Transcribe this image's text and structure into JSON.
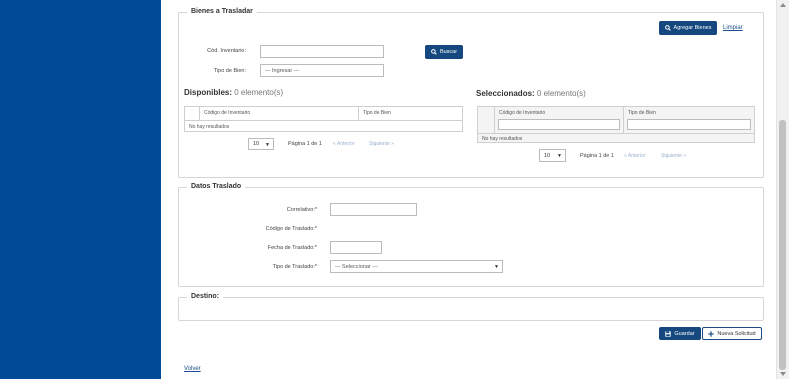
{
  "bienes": {
    "legend": "Bienes a Trasladar",
    "agregar_label": "Agregar Bienes",
    "limpiar_label": "Limpiar",
    "cod_inventario_label": "Cód. Inventario:",
    "cod_inventario_value": "",
    "tipo_bien_label": "Tipo de Bien:",
    "tipo_bien_value": "--- Ingresar ---",
    "buscar_label": "Buscar"
  },
  "disponibles": {
    "title": "Disponibles:",
    "count": "0 elemento(s)",
    "columns": [
      "Código de Inventario",
      "Tipo de Bien"
    ],
    "empty_text": "No hay resultados",
    "page_size": "10",
    "page_info": "Página 1 de 1",
    "prev_label": "« Anterior",
    "next_label": "Siguiente »"
  },
  "seleccionados": {
    "title": "Seleccionados:",
    "count": "0 elemento(s)",
    "columns": [
      "Código de Inventario",
      "Tipo de Bien"
    ],
    "empty_text": "No hay resultados",
    "page_size": "10",
    "page_info": "Página 1 de 1",
    "prev_label": "« Anterior",
    "next_label": "Siguiente »"
  },
  "datos": {
    "legend": "Datos Traslado",
    "correlativo_label": "Correlativo:*",
    "correlativo_value": "",
    "codigo_label": "Código de Traslado:*",
    "fecha_label": "Fecha de Traslado:*",
    "fecha_value": "",
    "tipo_label": "Tipo de Traslado:*",
    "tipo_value": "--- Seleccionar ---"
  },
  "destino": {
    "legend": "Destino:"
  },
  "actions": {
    "guardar_label": "Guardar",
    "nueva_label": "Nueva Solicitud",
    "volver_label": "Volver"
  },
  "colors": {
    "sidebar": "#014a97",
    "primary_button": "#14487f",
    "link": "#1a4e8c"
  },
  "icons": [
    "search-icon",
    "save-icon",
    "plus-icon",
    "caret-down-icon"
  ]
}
